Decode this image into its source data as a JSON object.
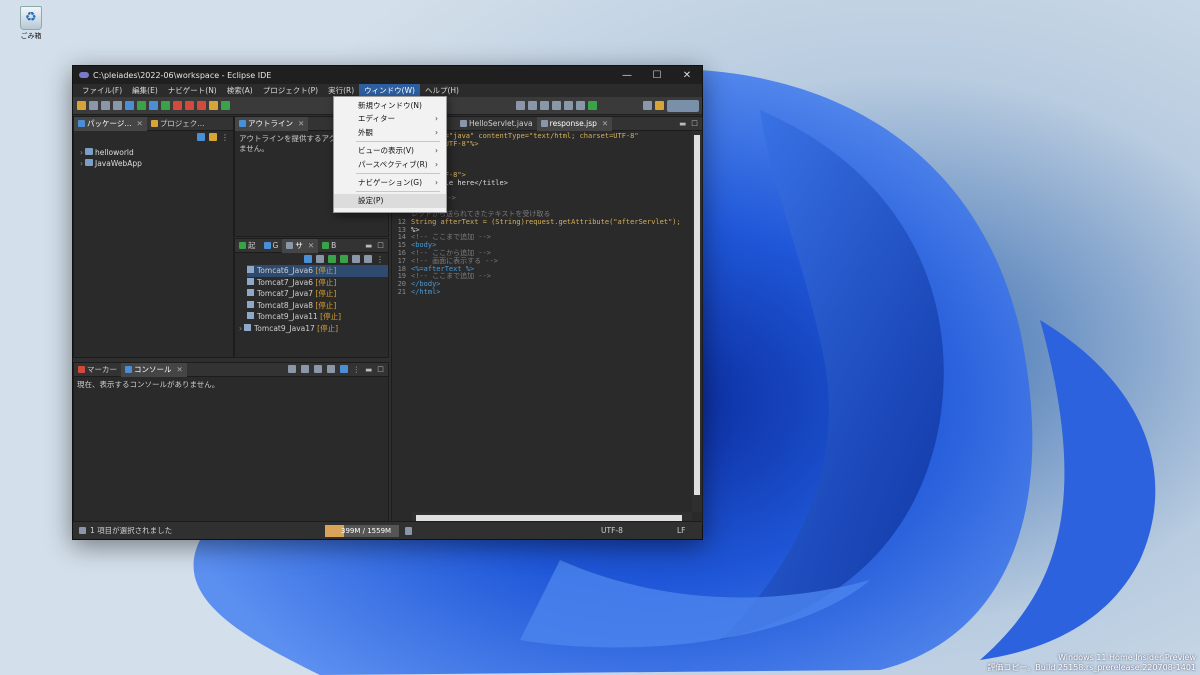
{
  "desktop": {
    "recycle_bin_label": "ごみ箱",
    "watermark_line1": "Windows 11 Home Insider Preview",
    "watermark_line2": "評価コピー。Build 25158.rs_prerelease.220708-1401"
  },
  "window": {
    "title": "C:\\pleiades\\2022-06\\workspace - Eclipse IDE",
    "minimize": "—",
    "maximize": "☐",
    "close": "✕"
  },
  "menubar": {
    "items": [
      "ファイル(F)",
      "編集(E)",
      "ナビゲート(N)",
      "検索(A)",
      "プロジェクト(P)",
      "実行(R)",
      "ウィンドウ(W)",
      "ヘルプ(H)"
    ]
  },
  "window_menu": {
    "items": [
      {
        "label": "新規ウィンドウ(N)",
        "submenu": false
      },
      {
        "label": "エディター",
        "submenu": true
      },
      {
        "label": "外観",
        "submenu": true
      },
      {
        "label": "ビューの表示(V)",
        "submenu": true
      },
      {
        "label": "パースペクティブ(R)",
        "submenu": true
      },
      {
        "label": "ナビゲーション(G)",
        "submenu": true
      },
      {
        "label": "設定(P)",
        "submenu": false
      }
    ]
  },
  "explorer": {
    "tab1": "パッケージ...",
    "tab2": "プロジェク...",
    "projects": [
      "helloworld",
      "JavaWebApp"
    ]
  },
  "outline": {
    "tab": "アウトライン",
    "message_line1": "アウトラインを提供するアクティブな",
    "message_line2": "ません。"
  },
  "servers": {
    "tabs": [
      "起",
      "G",
      "サ",
      "B"
    ],
    "items": [
      {
        "name": "Tomcat6_Java6",
        "state": "[停止]"
      },
      {
        "name": "Tomcat7_Java6",
        "state": "[停止]"
      },
      {
        "name": "Tomcat7_Java7",
        "state": "[停止]"
      },
      {
        "name": "Tomcat8_Java8",
        "state": "[停止]"
      },
      {
        "name": "Tomcat9_Java11",
        "state": "[停止]"
      },
      {
        "name": "Tomcat9_Java17",
        "state": "[停止]"
      }
    ]
  },
  "console": {
    "tab_markers": "マーカー",
    "tab_console": "コンソール",
    "message": "現在、表示するコンソールがありません。"
  },
  "editor": {
    "tabs": [
      "HelloServlet.java",
      "response.jsp"
    ],
    "lines": [
      {
        "n": "",
        "t": "language=\"java\" contentType=\"text/html; charset=UTF-8\""
      },
      {
        "n": "",
        "t": "coding=\"UTF-8\"%>"
      },
      {
        "n": "",
        "t": "html>"
      },
      {
        "n": "",
        "t": ""
      },
      {
        "n": "",
        "t": ""
      },
      {
        "n": "",
        "t": "rset=\"UTF-8\">"
      },
      {
        "n": "",
        "t": "sert title here</title>"
      },
      {
        "n": "",
        "t": ""
      },
      {
        "n": "",
        "t": "から追加 -->"
      },
      {
        "n": "",
        "t": ""
      },
      {
        "n": "",
        "t": "レットから送られてきたテキストを受け取る"
      },
      {
        "n": "12",
        "t": "String afterText = (String)request.getAttribute(\"afterServlet\");"
      },
      {
        "n": "13",
        "t": "%>"
      },
      {
        "n": "14",
        "t": "<!-- ここまで追加 -->"
      },
      {
        "n": "15",
        "t": "<body>"
      },
      {
        "n": "16",
        "t": "<!-- ここから追加 -->"
      },
      {
        "n": "17",
        "t": "<!-- 画面に表示する -->"
      },
      {
        "n": "18",
        "t": "<%=afterText %>"
      },
      {
        "n": "19",
        "t": "<!-- ここまで追加 -->"
      },
      {
        "n": "20",
        "t": "</body>"
      },
      {
        "n": "21",
        "t": "</html>"
      }
    ]
  },
  "statusbar": {
    "selection": "1 項目が選択されました",
    "memory": "399M / 1559M",
    "memory_used_fraction": 0.26,
    "encoding": "UTF-8",
    "line_ending": "LF"
  }
}
